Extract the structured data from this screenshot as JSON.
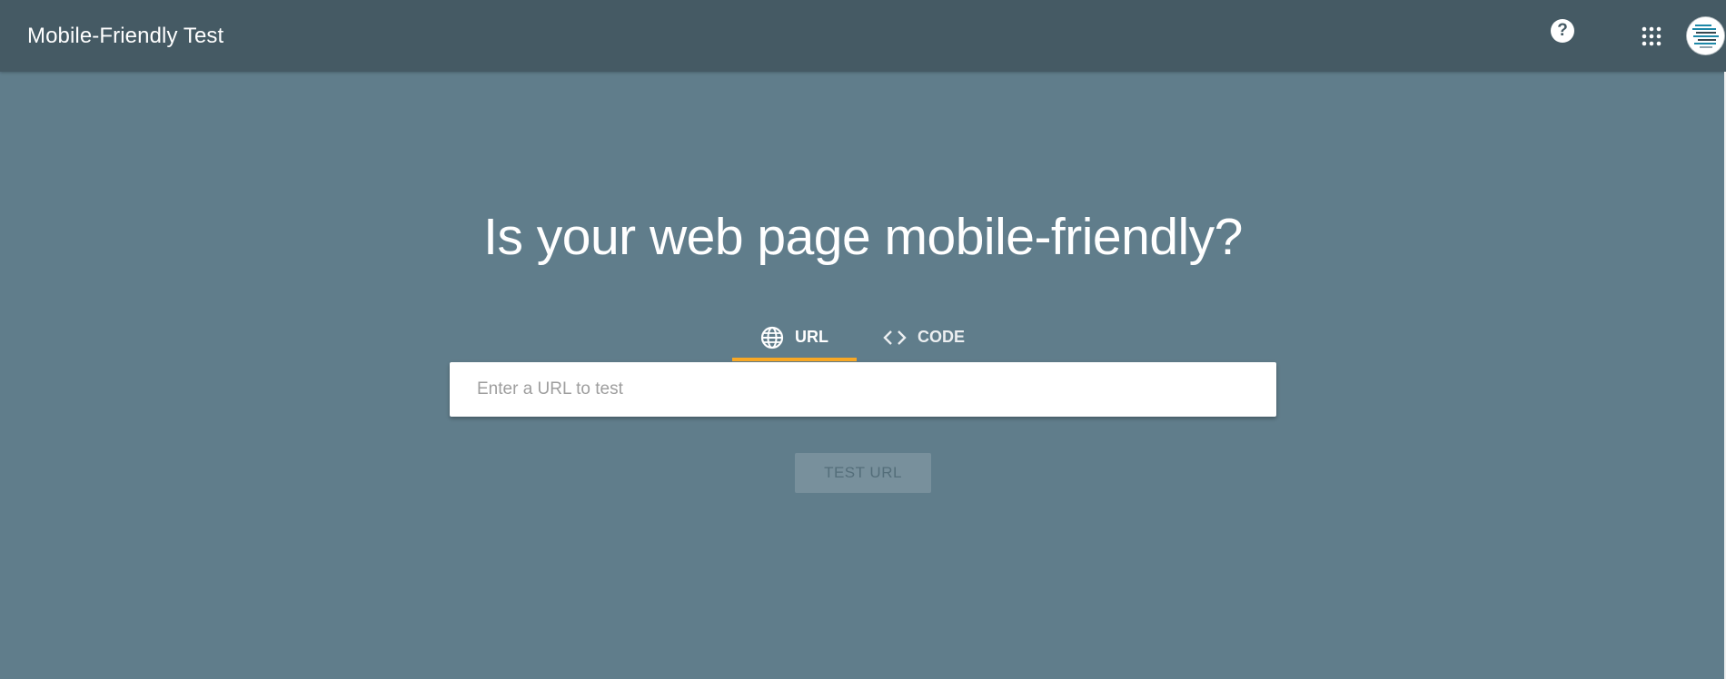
{
  "appbar": {
    "title": "Mobile-Friendly Test",
    "help_icon": "help-circle-icon",
    "help_label": "?",
    "apps_icon": "apps-grid-icon",
    "avatar_icon": "account-avatar-icon"
  },
  "main": {
    "headline": "Is your web page mobile-friendly?",
    "tabs": [
      {
        "label": "URL",
        "icon": "globe-icon",
        "active": true
      },
      {
        "label": "CODE",
        "icon": "code-icon",
        "active": false
      }
    ],
    "url_input": {
      "placeholder": "Enter a URL to test",
      "value": ""
    },
    "test_button": {
      "label": "TEST URL",
      "disabled": true
    }
  },
  "colors": {
    "background": "#607d8b",
    "appbar": "#455a64",
    "tab_indicator": "#f9a825",
    "input_bg": "#ffffff",
    "button_disabled_bg": "#78909c",
    "button_disabled_text": "#546e7a"
  }
}
